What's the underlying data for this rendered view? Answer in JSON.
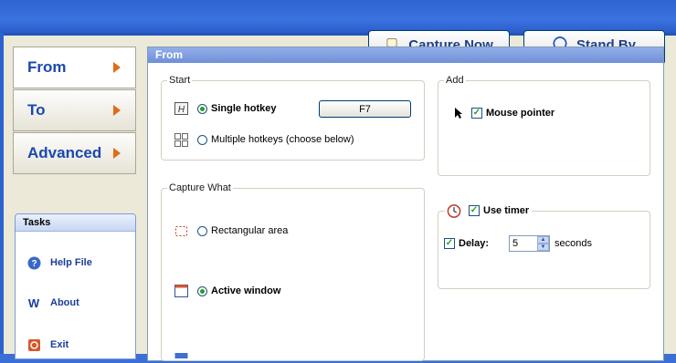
{
  "toolbar": {
    "capture_now_label": "Capture Now",
    "stand_by_label": "Stand By"
  },
  "nav": {
    "from_label": "From",
    "to_label": "To",
    "advanced_label": "Advanced"
  },
  "tasks": {
    "title": "Tasks",
    "help_label": "Help File",
    "about_label": "About",
    "exit_label": "Exit"
  },
  "panel": {
    "title": "From",
    "start": {
      "title": "Start",
      "single_hotkey_label": "Single hotkey",
      "hotkey_value": "F7",
      "multiple_hotkeys_label": "Multiple hotkeys  (choose below)"
    },
    "add": {
      "title": "Add",
      "mouse_pointer_label": "Mouse pointer"
    },
    "capture_what": {
      "title": "Capture What",
      "rectangular_label": "Rectangular area",
      "active_window_label": "Active window"
    },
    "timer": {
      "use_timer_label": "Use timer",
      "delay_label": "Delay:",
      "delay_value": "5",
      "seconds_label": "seconds"
    }
  },
  "colors": {
    "accent_blue": "#1b48b0",
    "arrow_orange": "#e06a18",
    "panel_header": "#7f9be0",
    "check_green": "#21a121"
  }
}
